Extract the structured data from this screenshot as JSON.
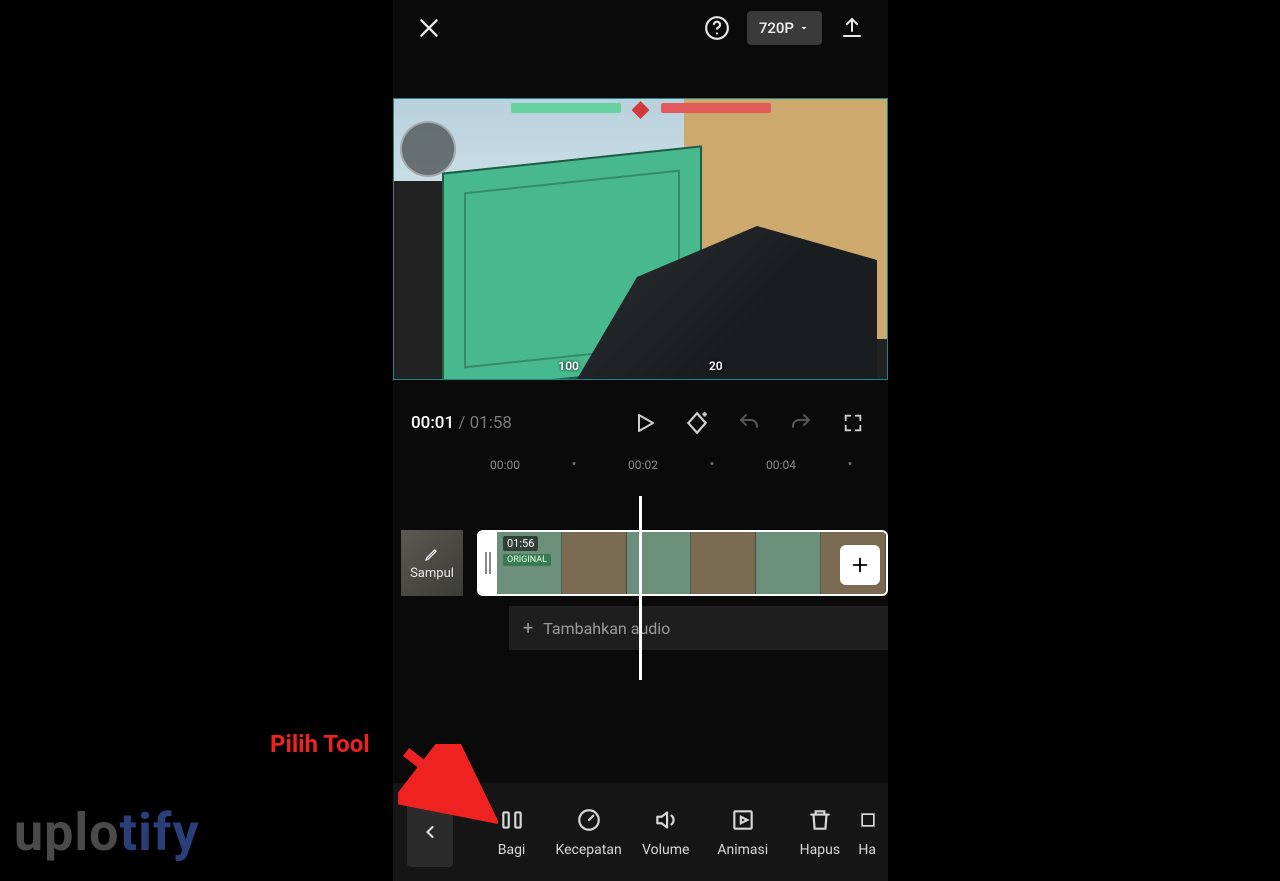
{
  "topbar": {
    "resolution_label": "720P"
  },
  "player": {
    "current_time": "00:01",
    "separator": " / ",
    "duration": "01:58"
  },
  "hud": {
    "stat_left": "100",
    "stat_right": "20"
  },
  "ruler": {
    "ticks": [
      "00:00",
      "00:02",
      "00:04"
    ]
  },
  "timeline": {
    "cover_label": "Sampul",
    "clip_duration": "01:56",
    "clip_tag": "ORIGINAL",
    "add_audio_label": "Tambahkan audio"
  },
  "tools": {
    "items": [
      {
        "id": "bagi",
        "label": "Bagi"
      },
      {
        "id": "kecepatan",
        "label": "Kecepatan"
      },
      {
        "id": "volume",
        "label": "Volume"
      },
      {
        "id": "animasi",
        "label": "Animasi"
      },
      {
        "id": "hapus",
        "label": "Hapus"
      },
      {
        "id": "hapus-bg",
        "label": "Ha"
      }
    ]
  },
  "annotation": {
    "text": "Pilih Tool"
  },
  "watermark": {
    "part1": "uplo",
    "part2": "tify"
  }
}
